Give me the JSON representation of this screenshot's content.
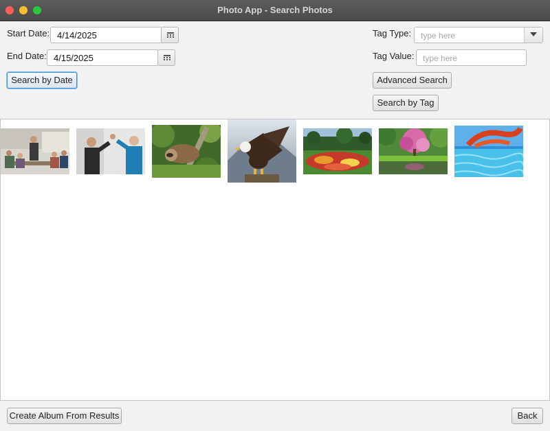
{
  "window": {
    "title": "Photo App - Search Photos"
  },
  "date_search": {
    "start_label": "Start Date:",
    "start_value": "4/14/2025",
    "end_label": "End Date:",
    "end_value": "4/15/2025",
    "search_button": "Search by Date"
  },
  "tag_search": {
    "type_label": "Tag Type:",
    "type_placeholder": "type here",
    "value_label": "Tag Value:",
    "value_placeholder": "type here",
    "advanced_button": "Advanced Search",
    "search_button": "Search by Tag"
  },
  "results": {
    "photos": [
      {
        "subject": "office meeting"
      },
      {
        "subject": "high five"
      },
      {
        "subject": "sloth"
      },
      {
        "subject": "eagle"
      },
      {
        "subject": "flower garden"
      },
      {
        "subject": "pink tree by pond"
      },
      {
        "subject": "water slide"
      }
    ]
  },
  "footer": {
    "create_album_button": "Create Album From Results",
    "back_button": "Back"
  },
  "icons": {
    "calendar": "calendar-icon",
    "dropdown": "chevron-down-icon"
  },
  "colors": {
    "focus": "#3d8ed8",
    "titlebar": "#4f4f4f"
  }
}
